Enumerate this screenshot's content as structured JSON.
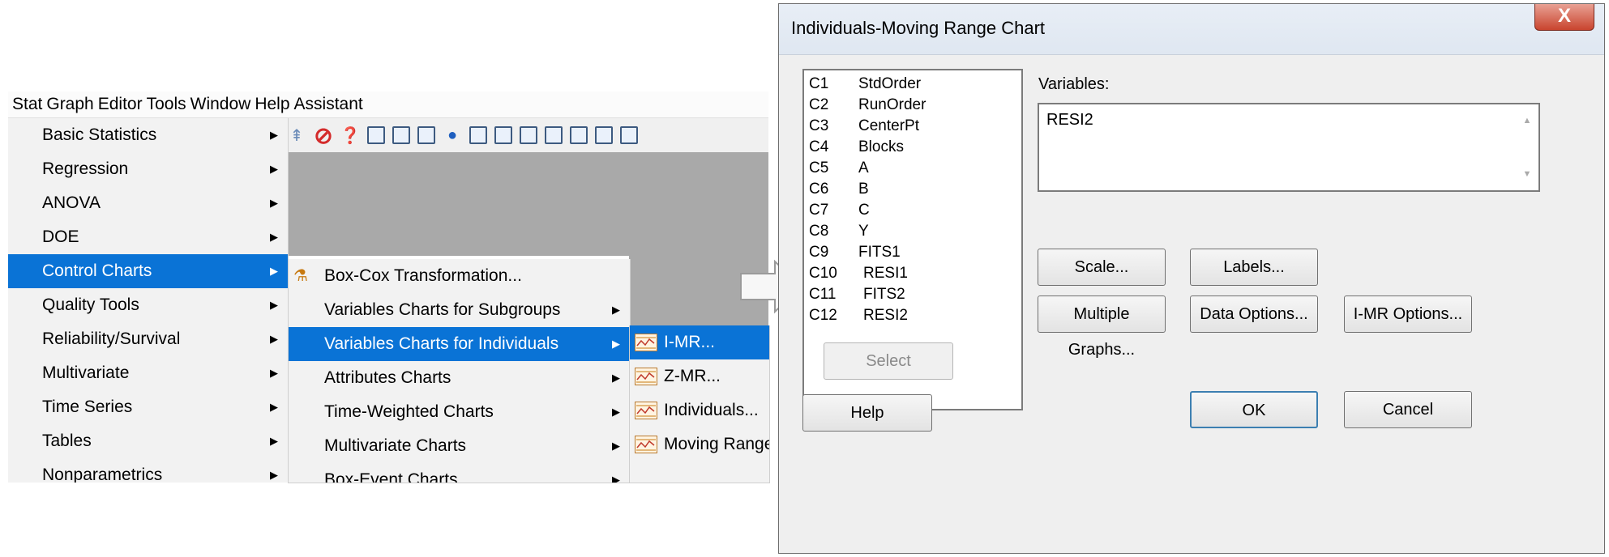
{
  "menubar": [
    "Stat",
    "Graph",
    "Editor",
    "Tools",
    "Window",
    "Help",
    "Assistant"
  ],
  "stat_menu": [
    {
      "label": "Basic Statistics"
    },
    {
      "label": "Regression"
    },
    {
      "label": "ANOVA"
    },
    {
      "label": "DOE"
    },
    {
      "label": "Control Charts",
      "selected": true
    },
    {
      "label": "Quality Tools"
    },
    {
      "label": "Reliability/Survival"
    },
    {
      "label": "Multivariate"
    },
    {
      "label": "Time Series"
    },
    {
      "label": "Tables"
    },
    {
      "label": "Nonparametrics"
    }
  ],
  "control_charts_menu": [
    {
      "label": "Box-Cox Transformation..."
    },
    {
      "label": "Variables Charts for Subgroups"
    },
    {
      "label": "Variables Charts for Individuals",
      "selected": true
    },
    {
      "label": "Attributes Charts"
    },
    {
      "label": "Time-Weighted Charts"
    },
    {
      "label": "Multivariate Charts"
    },
    {
      "label": "Box-Event Charts"
    }
  ],
  "individuals_menu": [
    {
      "label": "I-MR...",
      "selected": true
    },
    {
      "label": "Z-MR..."
    },
    {
      "label": "Individuals..."
    },
    {
      "label": "Moving Range..."
    }
  ],
  "dialog": {
    "title": "Individuals-Moving Range Chart",
    "close": "X",
    "columns": [
      {
        "id": "C1",
        "name": "StdOrder"
      },
      {
        "id": "C2",
        "name": "RunOrder"
      },
      {
        "id": "C3",
        "name": "CenterPt"
      },
      {
        "id": "C4",
        "name": "Blocks"
      },
      {
        "id": "C5",
        "name": "A"
      },
      {
        "id": "C6",
        "name": "B"
      },
      {
        "id": "C7",
        "name": "C"
      },
      {
        "id": "C8",
        "name": "Y"
      },
      {
        "id": "C9",
        "name": "FITS1"
      },
      {
        "id": "C10",
        "name": "RESI1"
      },
      {
        "id": "C11",
        "name": "FITS2"
      },
      {
        "id": "C12",
        "name": "RESI2"
      }
    ],
    "variables_label": "Variables:",
    "variables_value": "RESI2",
    "buttons": {
      "scale": "Scale...",
      "labels": "Labels...",
      "multiple_graphs": "Multiple Graphs...",
      "data_options": "Data Options...",
      "imr_options": "I-MR Options...",
      "select": "Select",
      "help": "Help",
      "ok": "OK",
      "cancel": "Cancel"
    }
  }
}
